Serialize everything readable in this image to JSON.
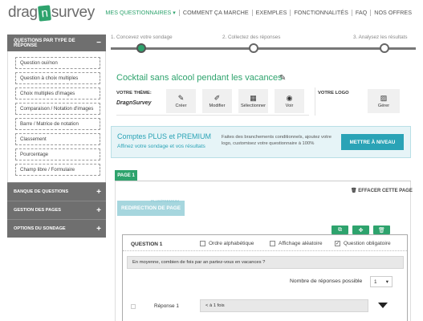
{
  "logo": {
    "left": "drag",
    "n": "n",
    "right": "survey"
  },
  "nav": {
    "items": [
      {
        "label": "MES QUESTIONNAIRES ▾",
        "active": true
      },
      {
        "label": "COMMENT ÇA MARCHE"
      },
      {
        "label": "EXEMPLES"
      },
      {
        "label": "FONCTIONNALITÉS"
      },
      {
        "label": "FAQ"
      },
      {
        "label": "NOS OFFRES"
      }
    ]
  },
  "sidebar": {
    "question_types": {
      "title": "QUESTIONS PAR TYPE DE RÉPONSE",
      "toggle": "−",
      "items": [
        "Question oui/non",
        "Question à choix multiples",
        "Choix multiples d'images",
        "Comparaison / Notation d'images",
        "Barre / Matrice de notation",
        "Classement",
        "Pourcentage",
        "Champ libre / Formulaire"
      ]
    },
    "sections": [
      {
        "label": "BANQUE DE QUESTIONS",
        "toggle": "+"
      },
      {
        "label": "GESTION DES PAGES",
        "toggle": "+"
      },
      {
        "label": "OPTIONS DU SONDAGE",
        "toggle": "+"
      }
    ]
  },
  "steps": {
    "items": [
      {
        "label": "1. Concevez votre sondage",
        "active": true
      },
      {
        "label": "2. Collectez des réponses",
        "active": false
      },
      {
        "label": "3. Analysez les résultats",
        "active": false
      }
    ]
  },
  "survey": {
    "title": "Cocktail sans alcool pendant les vacances",
    "edit_icon": "pencil-icon"
  },
  "theme": {
    "label": "VOTRE THÈME:",
    "name": "DragnSurvey",
    "buttons": [
      {
        "label": "Créer",
        "icon": "edit-icon",
        "glyph": "✎"
      },
      {
        "label": "Modifier",
        "icon": "brush-icon",
        "glyph": "✐"
      },
      {
        "label": "Sélectionner",
        "icon": "grid-icon",
        "glyph": "▦"
      },
      {
        "label": "Voir",
        "icon": "eye-icon",
        "glyph": "◉"
      }
    ]
  },
  "logo_section": {
    "label": "VOTRE LOGO",
    "button": {
      "label": "Gérer",
      "icon": "image-icon",
      "glyph": "▨"
    }
  },
  "premium": {
    "title": "Comptes PLUS et PREMIUM",
    "subtitle": "Affinez votre sondage et vos résultats",
    "text": "Faites des branchements conditionnels, ajoutez votre logo, customisez votre questionnaire à 100%",
    "button": "METTRE À NIVEAU",
    "accent": "#2aa3b6"
  },
  "page": {
    "tab": "PAGE 1",
    "clear": "🗑 EFFACER CETTE PAGE",
    "plus_tag": "PLUS/PREMIUM",
    "redirect": "REDIRECTION DE PAGE",
    "tools": [
      {
        "icon": "copy-icon",
        "glyph": "⧉"
      },
      {
        "icon": "move-icon",
        "glyph": "✥"
      },
      {
        "icon": "trash-icon",
        "glyph": "🗑"
      }
    ]
  },
  "question": {
    "number": "QUESTION 1",
    "options": [
      {
        "label": "Ordre alphabétique",
        "checked": false
      },
      {
        "label": "Affichage aléatoire",
        "checked": false
      },
      {
        "label": "Question obligatoire",
        "checked": true
      }
    ],
    "text": "En moyenne, combien de fois par an partez-vous en vacances ?",
    "nb_label": "Nombre de réponses possible",
    "nb_value": "1",
    "response_label": "Réponse 1",
    "response_value": "< à 1 fois"
  },
  "colors": {
    "brand_green": "#2ea36d",
    "sidebar_grey": "#6f6f6f"
  }
}
